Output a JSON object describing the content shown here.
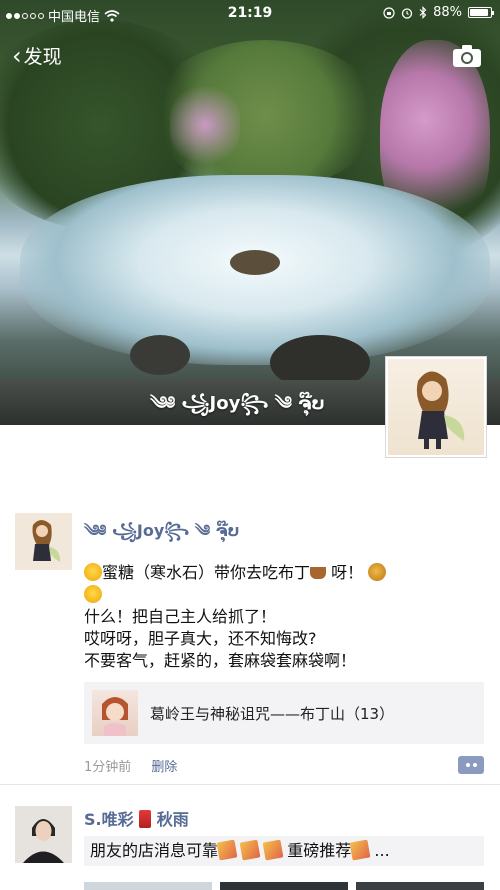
{
  "status_bar": {
    "carrier": "中国电信",
    "time": "21:19",
    "battery": "88%",
    "battery_level": 0.88
  },
  "nav": {
    "back_label": "发现",
    "camera_icon": "camera-icon"
  },
  "cover": {
    "owner_name": "༄༅ ꧁Joy꧂ ༄ ຈຸ໊ບ"
  },
  "posts": [
    {
      "name": "༄༅ ꧁Joy꧂ ༄ ຈຸ໊ບ",
      "text_line1_a": "蜜糖（寒水石）带你去吃布丁",
      "text_line1_b": "呀！",
      "text_line3": "什么！把自己主人给抓了！",
      "text_line4": "哎呀呀，胆子真大，还不知悔改?",
      "text_line5": "不要客气，赶紧的，套麻袋套麻袋啊！",
      "link_title": "葛岭王与神秘诅咒——布丁山（13）",
      "time": "1分钟前",
      "delete_label": "删除"
    },
    {
      "name_a": "S.唯彩",
      "name_b": "秋雨",
      "text_a": "朋友的店消息可靠",
      "text_b": "重磅推荐",
      "text_c": "..."
    }
  ],
  "colors": {
    "link_blue": "#576b95",
    "meta_gray": "#9a9a9a",
    "card_bg": "#f3f3f5"
  }
}
